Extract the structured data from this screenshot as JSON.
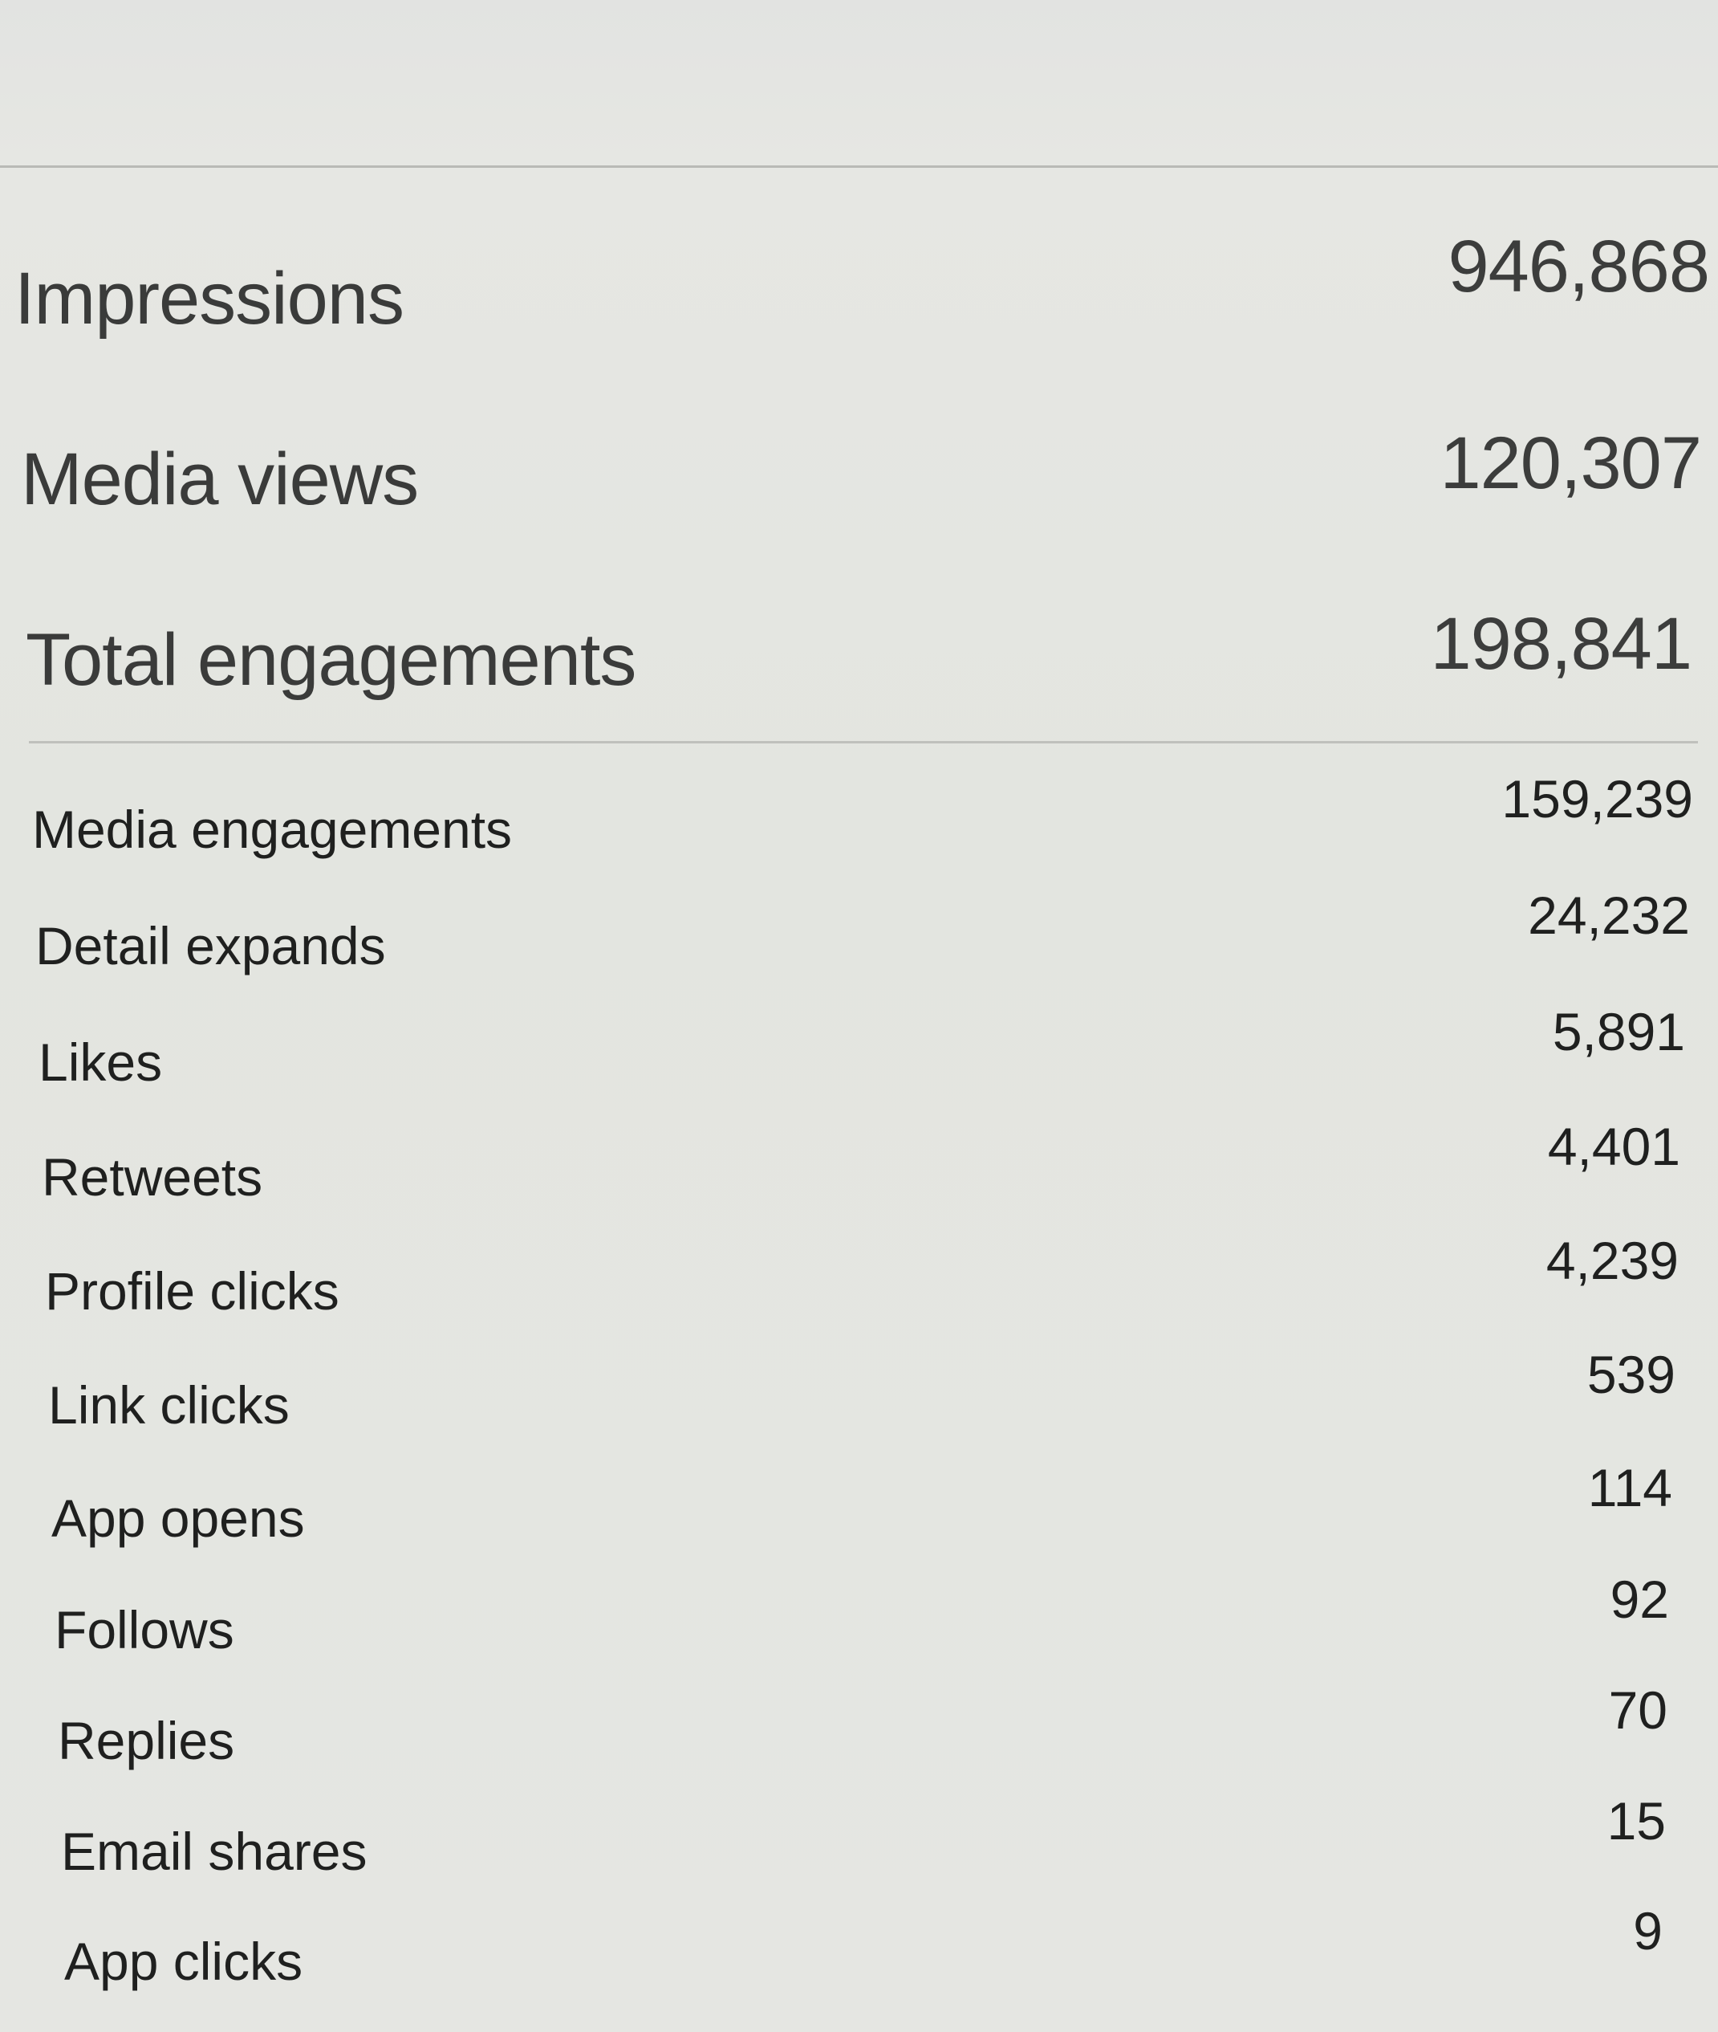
{
  "summary": [
    {
      "label": "Impressions",
      "value": "946,868"
    },
    {
      "label": "Media views",
      "value": "120,307"
    },
    {
      "label": "Total engagements",
      "value": "198,841"
    }
  ],
  "engagements": [
    {
      "label": "Media engagements",
      "value": "159,239"
    },
    {
      "label": "Detail expands",
      "value": "24,232"
    },
    {
      "label": "Likes",
      "value": "5,891"
    },
    {
      "label": "Retweets",
      "value": "4,401"
    },
    {
      "label": "Profile clicks",
      "value": "4,239"
    },
    {
      "label": "Link clicks",
      "value": "539"
    },
    {
      "label": "App opens",
      "value": "114"
    },
    {
      "label": "Follows",
      "value": "92"
    },
    {
      "label": "Replies",
      "value": "70"
    },
    {
      "label": "Email shares",
      "value": "15"
    },
    {
      "label": "App clicks",
      "value": "9"
    }
  ]
}
